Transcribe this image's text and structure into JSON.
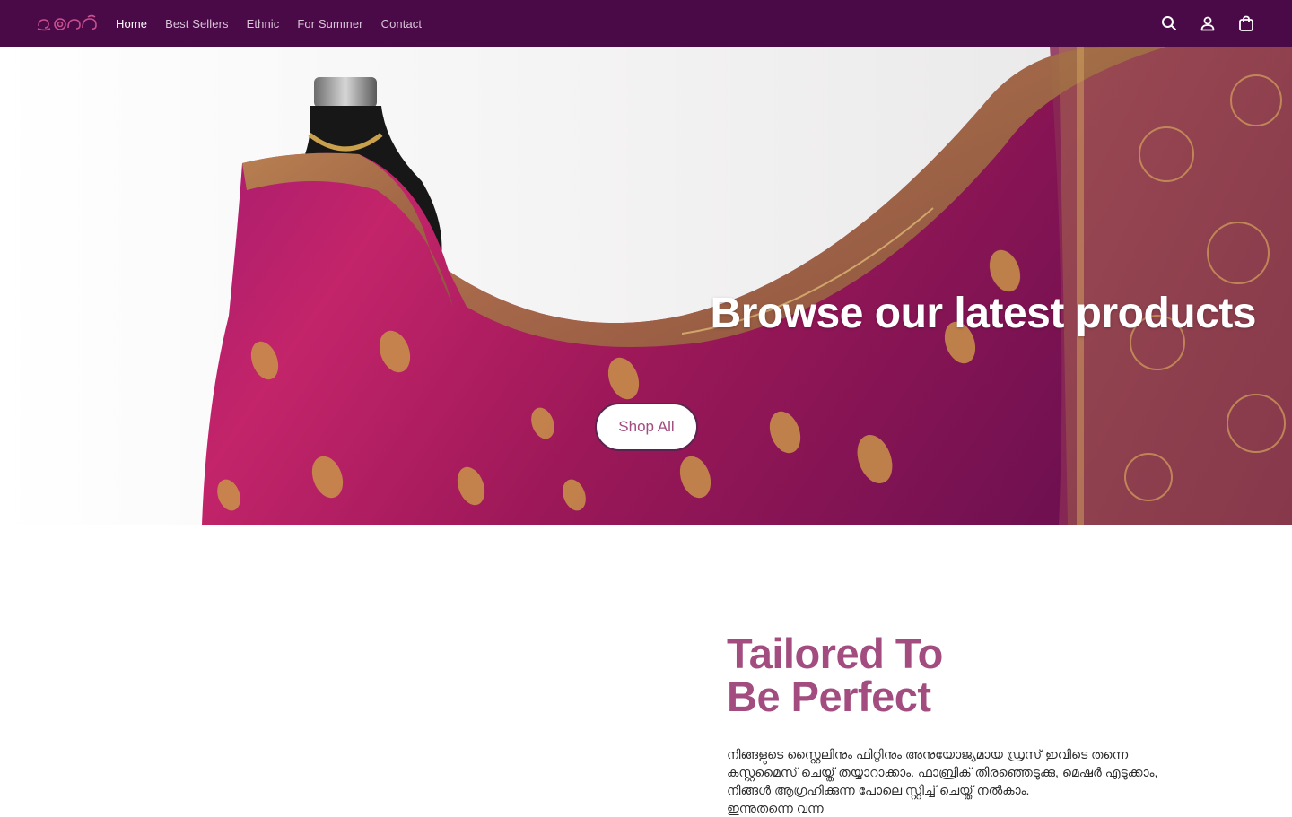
{
  "header": {
    "logo_text": "ഇരൾ",
    "nav": [
      {
        "label": "Home",
        "active": true
      },
      {
        "label": "Best Sellers",
        "active": false
      },
      {
        "label": "Ethnic",
        "active": false
      },
      {
        "label": "For Summer",
        "active": false
      },
      {
        "label": "Contact",
        "active": false
      }
    ],
    "icons": [
      "search-icon",
      "account-icon",
      "cart-icon"
    ]
  },
  "hero": {
    "title": "Browse our latest products",
    "button_label": "Shop All"
  },
  "feature": {
    "title_line1": "Tailored To",
    "title_line2": "Be Perfect",
    "text_lines": [
      "നിങ്ങളുടെ സ്റ്റൈലിനും ഫിറ്റിനും അനുയോജ്യമായ ഡ്രസ് ഇവിടെ തന്നെ",
      "കസ്റ്റമൈസ് ചെയ്ത് തയ്യാറാക്കാം. ഫാബ്രിക് തിരഞ്ഞെടുക്കു, മെഷർ എടുക്കാം,",
      "നിങ്ങൾ ആഗ്രഹിക്കുന്ന പോലെ സ്റ്റിച്ച് ചെയ്ത് നൽകാം.",
      "ഇന്നുതന്നെ വന്ന"
    ]
  },
  "colors": {
    "header_bg": "#4a0a47",
    "accent": "#a24c80",
    "saree": "#b0185e"
  }
}
